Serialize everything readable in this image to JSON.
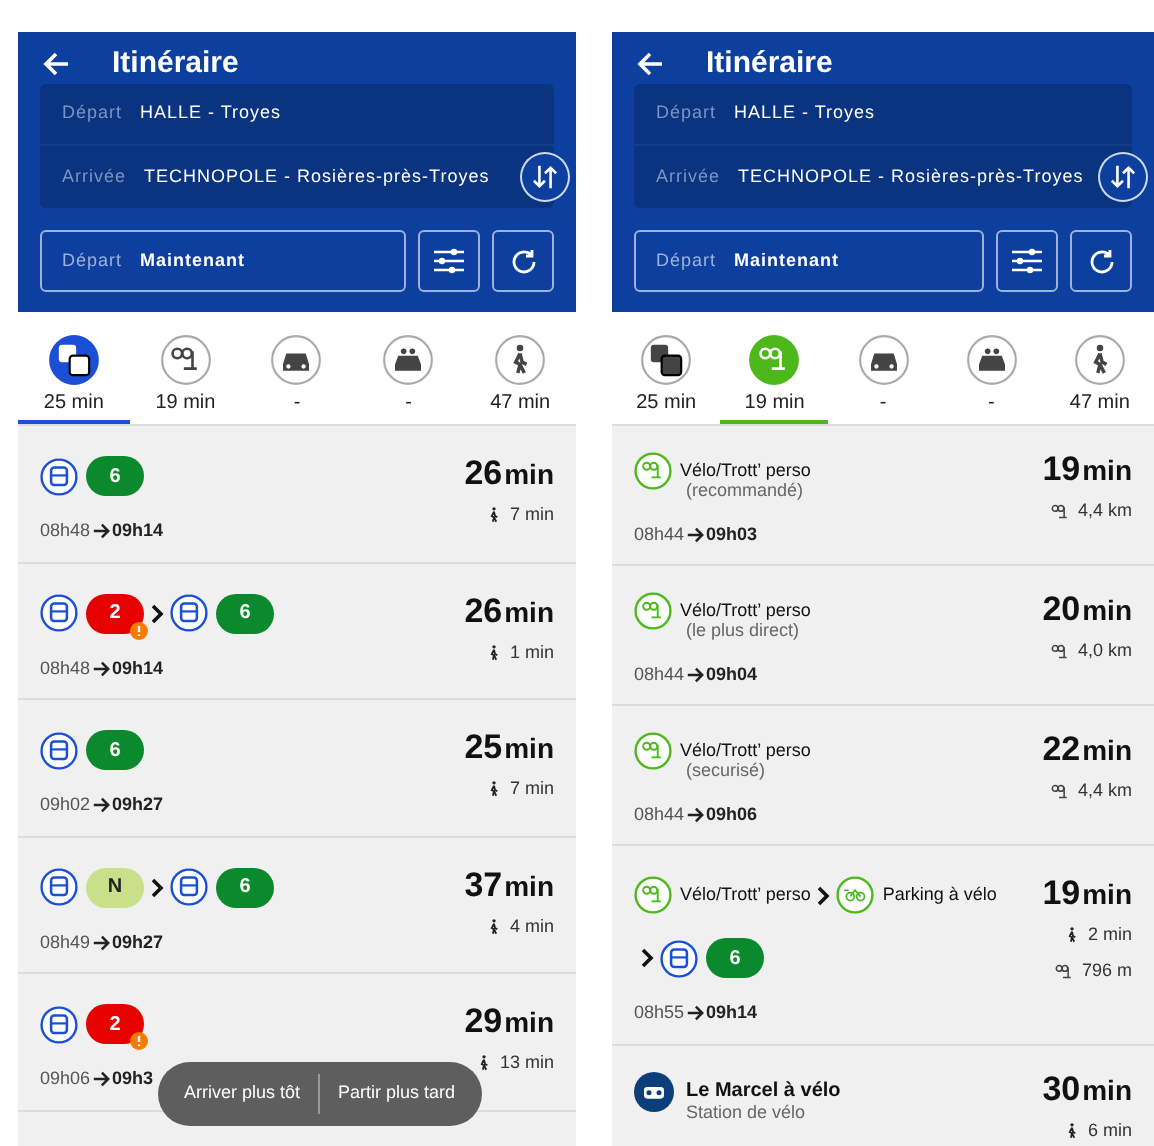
{
  "screens": [
    {
      "header": {
        "title": "Itinéraire",
        "from_label": "Départ",
        "from_value": "HALLE - Troyes",
        "to_label": "Arrivée",
        "to_value": "TECHNOPOLE - Rosières-près-Troyes",
        "time_label": "Départ",
        "time_value": "Maintenant"
      },
      "modes": [
        {
          "kind": "transit",
          "label": "25 min",
          "selected": true
        },
        {
          "kind": "bike",
          "label": "19 min",
          "selected": false
        },
        {
          "kind": "car",
          "label": "-",
          "selected": false
        },
        {
          "kind": "carpool",
          "label": "-",
          "selected": false
        },
        {
          "kind": "walk",
          "label": "47 min",
          "selected": false
        }
      ],
      "results": [
        {
          "steps": [
            {
              "kind": "bus",
              "line": "6",
              "color": "#0a8a2c",
              "alert": false
            }
          ],
          "start": "08h48",
          "end": "09h14",
          "duration": "26",
          "unit": "min",
          "extras": [
            {
              "kind": "walk",
              "text": "7 min"
            }
          ]
        },
        {
          "steps": [
            {
              "kind": "bus",
              "line": "2",
              "color": "#e60000",
              "alert": true
            },
            {
              "kind": "bus",
              "line": "6",
              "color": "#0a8a2c",
              "alert": false
            }
          ],
          "start": "08h48",
          "end": "09h14",
          "duration": "26",
          "unit": "min",
          "extras": [
            {
              "kind": "walk",
              "text": "1 min"
            }
          ]
        },
        {
          "steps": [
            {
              "kind": "bus",
              "line": "6",
              "color": "#0a8a2c",
              "alert": false
            }
          ],
          "start": "09h02",
          "end": "09h27",
          "duration": "25",
          "unit": "min",
          "extras": [
            {
              "kind": "walk",
              "text": "7 min"
            }
          ]
        },
        {
          "steps": [
            {
              "kind": "bus",
              "line": "N",
              "color": "#c8e08a",
              "alert": false
            },
            {
              "kind": "bus",
              "line": "6",
              "color": "#0a8a2c",
              "alert": false
            }
          ],
          "start": "08h49",
          "end": "09h27",
          "duration": "37",
          "unit": "min",
          "extras": [
            {
              "kind": "walk",
              "text": "4 min"
            }
          ]
        },
        {
          "steps": [
            {
              "kind": "bus",
              "line": "2",
              "color": "#e60000",
              "alert": true
            }
          ],
          "start": "09h06",
          "end": "09h3",
          "duration": "29",
          "unit": "min",
          "extras": [
            {
              "kind": "walk",
              "text": "13 min"
            }
          ]
        }
      ],
      "toast": {
        "actions": [
          "Arriver plus tôt",
          "Partir plus tard"
        ]
      }
    },
    {
      "header": {
        "title": "Itinéraire",
        "from_label": "Départ",
        "from_value": "HALLE - Troyes",
        "to_label": "Arrivée",
        "to_value": "TECHNOPOLE - Rosières-près-Troyes",
        "time_label": "Départ",
        "time_value": "Maintenant"
      },
      "modes": [
        {
          "kind": "transit",
          "label": "25 min",
          "selected": false
        },
        {
          "kind": "bike",
          "label": "19 min",
          "selected": true
        },
        {
          "kind": "car",
          "label": "-",
          "selected": false
        },
        {
          "kind": "carpool",
          "label": "-",
          "selected": false
        },
        {
          "kind": "walk",
          "label": "47 min",
          "selected": false
        }
      ],
      "results": [
        {
          "steps": [
            {
              "kind": "bike",
              "label": "Vélo/Trott’ perso"
            }
          ],
          "note": "(recommandé)",
          "start": "08h44",
          "end": "09h03",
          "duration": "19",
          "unit": "min",
          "extras": [
            {
              "kind": "bike",
              "text": "4,4 km"
            }
          ]
        },
        {
          "steps": [
            {
              "kind": "bike",
              "label": "Vélo/Trott’ perso"
            }
          ],
          "note": "(le plus direct)",
          "start": "08h44",
          "end": "09h04",
          "duration": "20",
          "unit": "min",
          "extras": [
            {
              "kind": "bike",
              "text": "4,0 km"
            }
          ]
        },
        {
          "steps": [
            {
              "kind": "bike",
              "label": "Vélo/Trott’ perso"
            }
          ],
          "note": "(securisé)",
          "start": "08h44",
          "end": "09h06",
          "duration": "22",
          "unit": "min",
          "extras": [
            {
              "kind": "bike",
              "text": "4,4 km"
            }
          ]
        },
        {
          "steps": [
            {
              "kind": "bike",
              "label": "Vélo/Trott’ perso"
            },
            {
              "kind": "parking",
              "label": "Parking à vélo"
            },
            {
              "kind": "bus",
              "line": "6",
              "color": "#0a8a2c",
              "alert": false
            }
          ],
          "start": "08h55",
          "end": "09h14",
          "duration": "19",
          "unit": "min",
          "extras": [
            {
              "kind": "walk",
              "text": "2 min"
            },
            {
              "kind": "bike",
              "text": "796 m"
            }
          ]
        },
        {
          "steps": [
            {
              "kind": "station",
              "label": "Le Marcel à vélo"
            }
          ],
          "note": "Station de vélo",
          "duration": "30",
          "unit": "min",
          "extras": [
            {
              "kind": "walk",
              "text": "6 min"
            }
          ]
        }
      ]
    }
  ]
}
